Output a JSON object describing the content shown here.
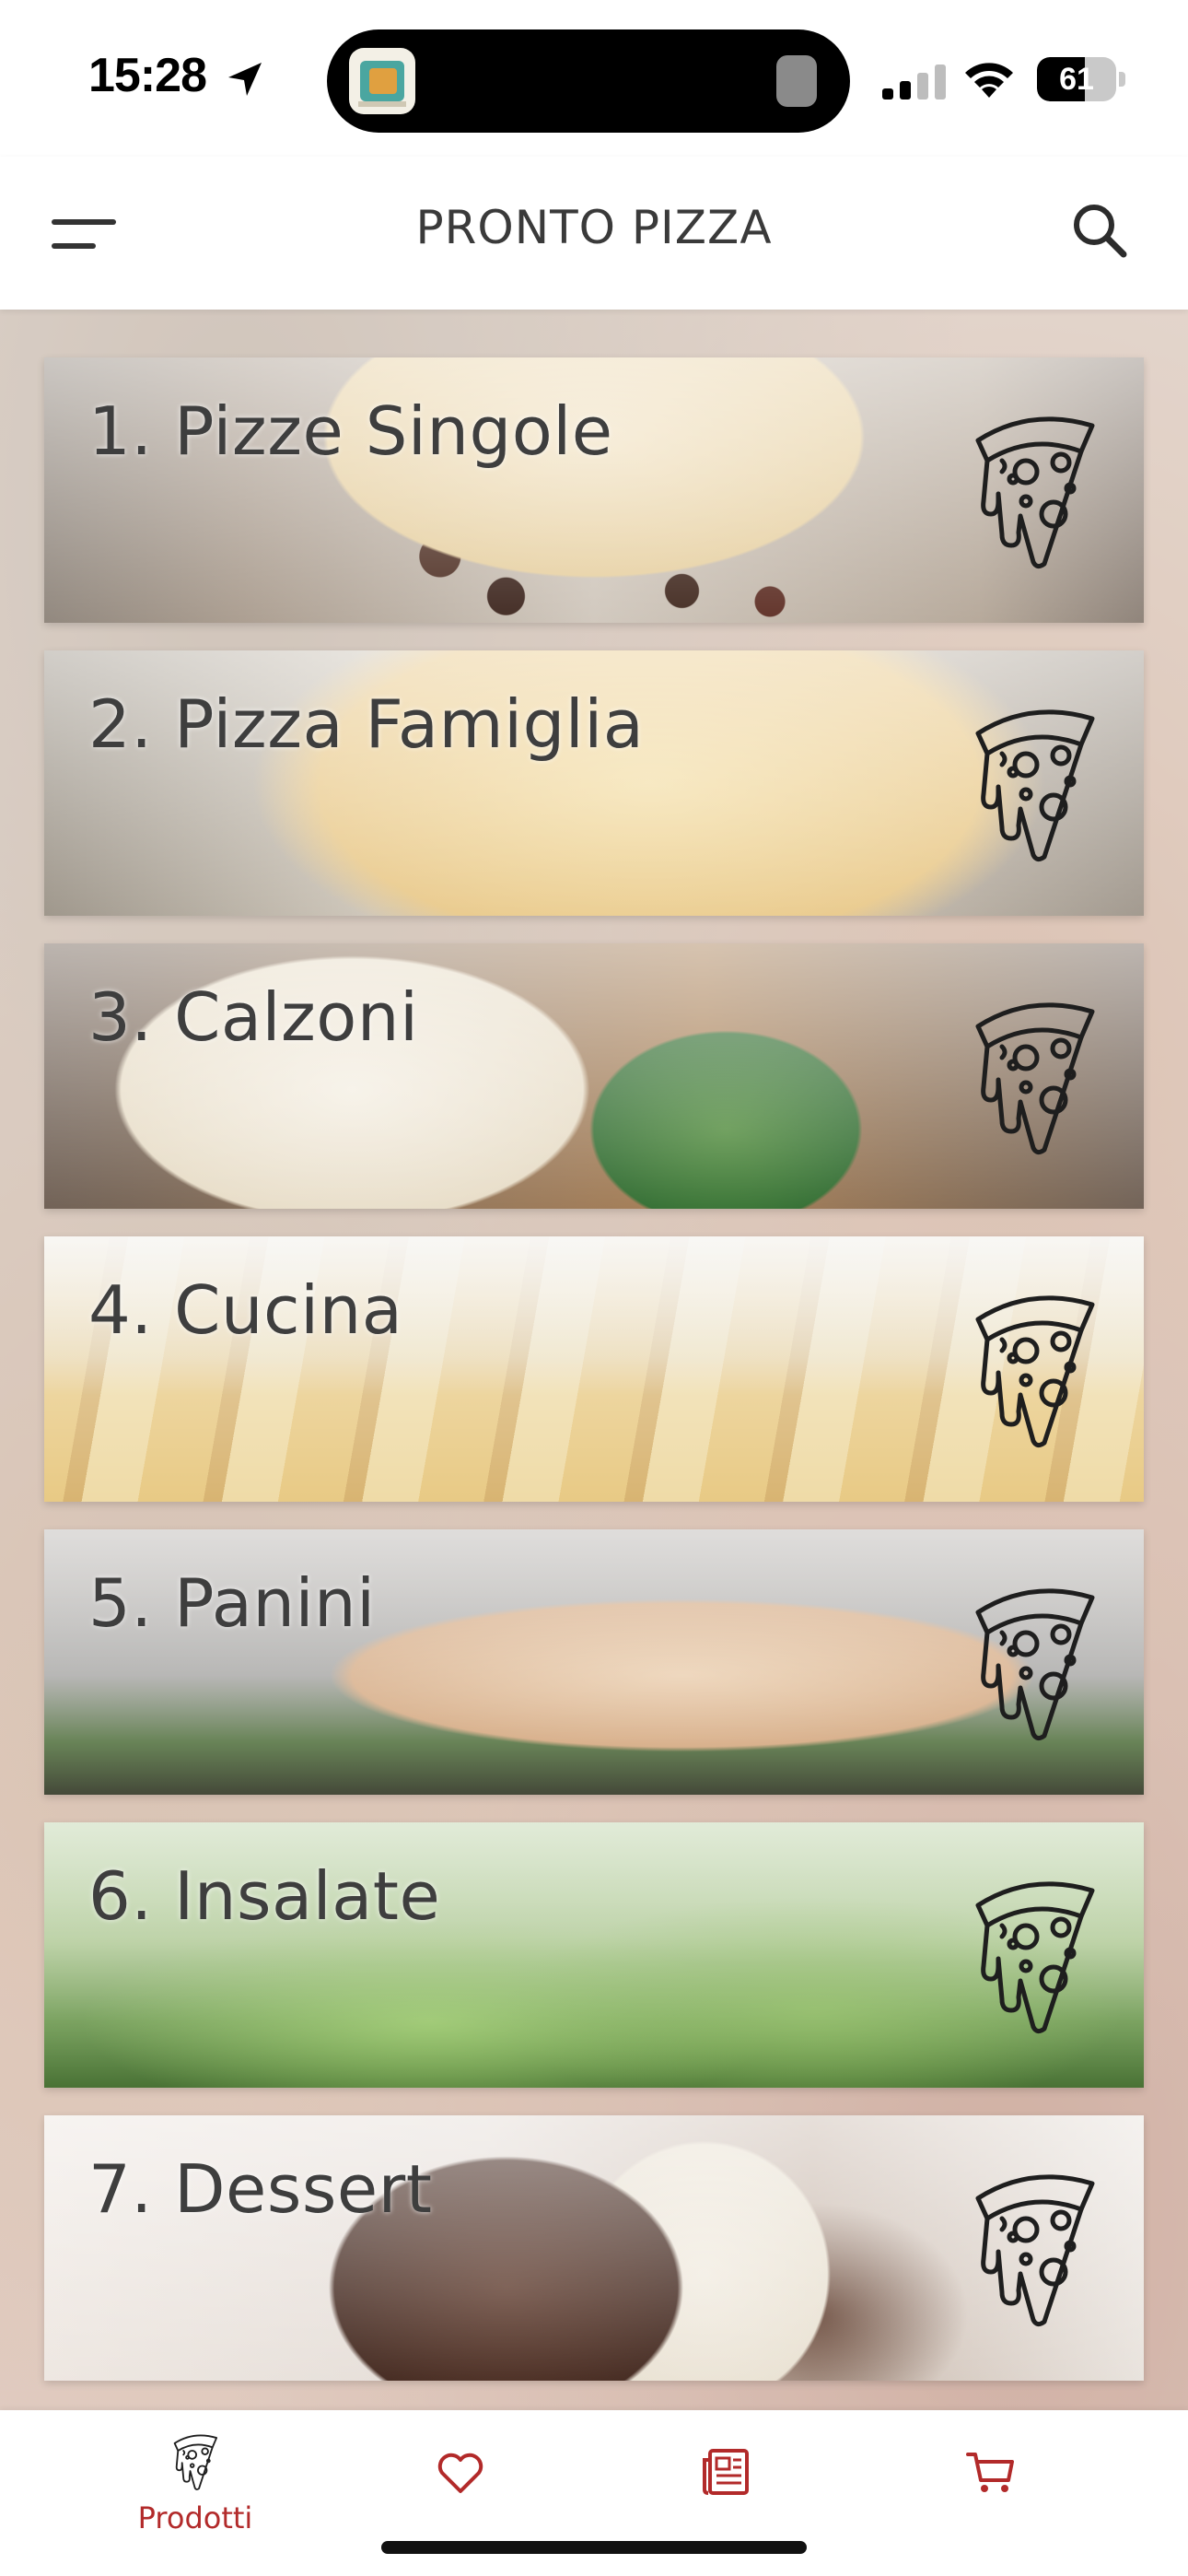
{
  "status_bar": {
    "time": "15:28",
    "battery_level": 61,
    "battery_text": "61",
    "location_icon": "location-arrow-icon",
    "signal_icon": "cellular-signal-icon",
    "wifi_icon": "wifi-icon"
  },
  "header": {
    "title": "PRONTO PIZZA",
    "menu_icon": "menu-icon",
    "search_icon": "search-icon"
  },
  "categories": [
    {
      "label": "1. Pizze Singole",
      "icon": "pizza-slice-icon"
    },
    {
      "label": "2. Pizza Famiglia",
      "icon": "pizza-slice-icon"
    },
    {
      "label": "3. Calzoni",
      "icon": "pizza-slice-icon"
    },
    {
      "label": "4. Cucina",
      "icon": "pizza-slice-icon"
    },
    {
      "label": "5. Panini",
      "icon": "pizza-slice-icon"
    },
    {
      "label": "6. Insalate",
      "icon": "pizza-slice-icon"
    },
    {
      "label": "7. Dessert",
      "icon": "pizza-slice-icon"
    }
  ],
  "bottom_nav": {
    "items": [
      {
        "label": "Prodotti",
        "icon": "pizza-slice-icon",
        "active": true
      },
      {
        "label": "",
        "icon": "heart-icon",
        "active": false
      },
      {
        "label": "",
        "icon": "newspaper-icon",
        "active": false
      },
      {
        "label": "",
        "icon": "cart-icon",
        "active": false
      }
    ]
  },
  "colors": {
    "accent": "#b22a2a",
    "title_text": "#3a3a3a",
    "card_text": "#3e3e3e"
  }
}
